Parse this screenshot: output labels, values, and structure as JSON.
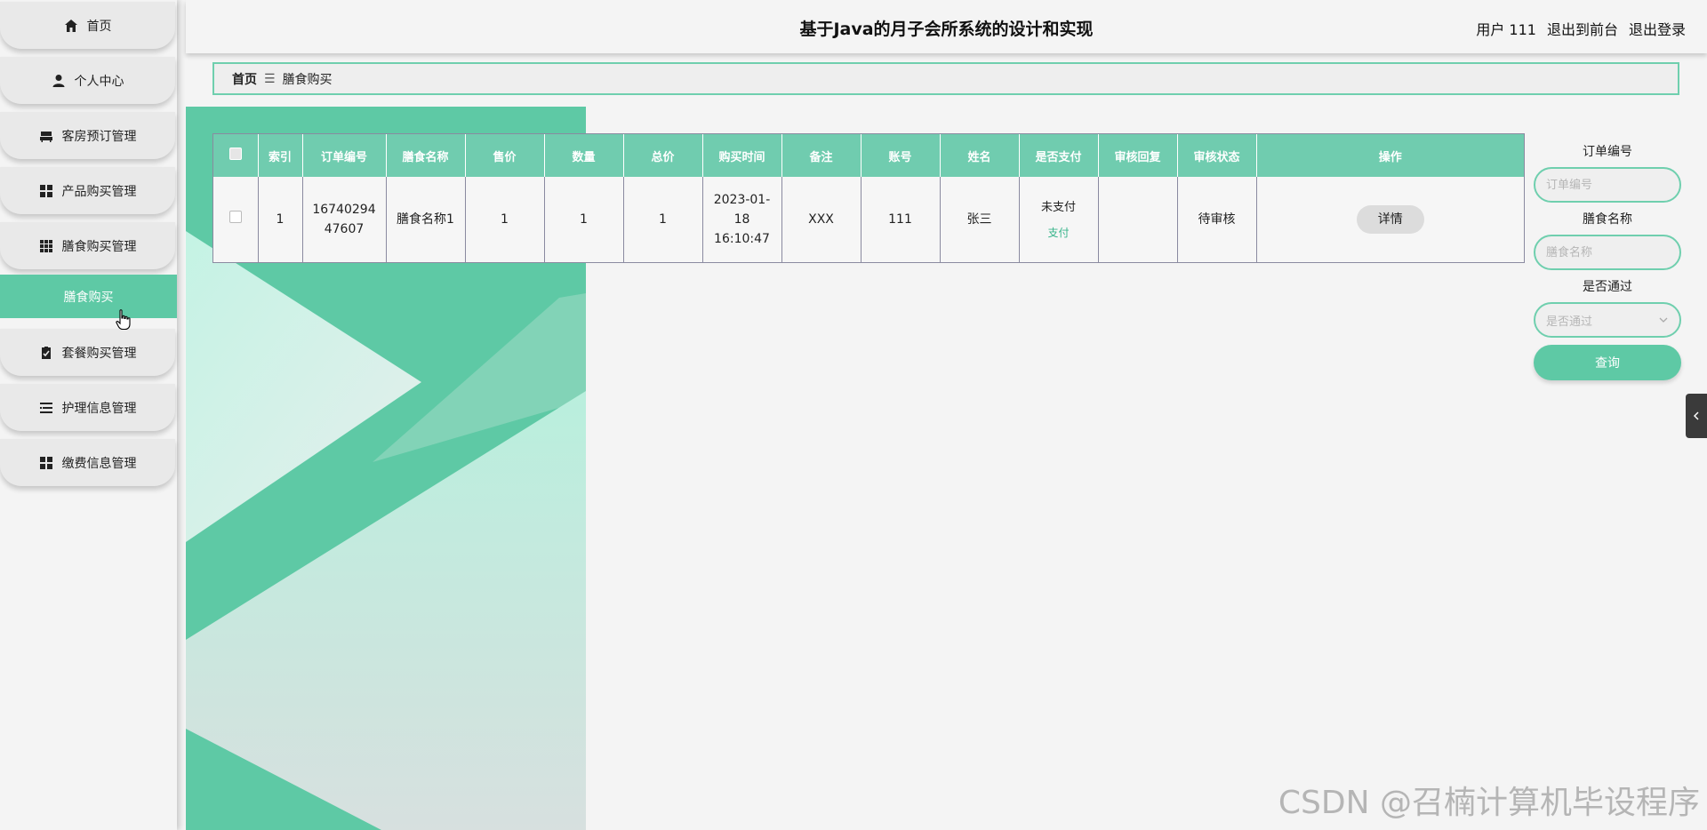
{
  "sidebar": {
    "items": [
      {
        "label": "首页",
        "icon": "home-icon"
      },
      {
        "label": "个人中心",
        "icon": "user-icon"
      },
      {
        "label": "客房预订管理",
        "icon": "bed-icon"
      },
      {
        "label": "产品购买管理",
        "icon": "grid-icon"
      },
      {
        "label": "膳食购买管理",
        "icon": "apps-icon"
      },
      {
        "label": "套餐购买管理",
        "icon": "clipboard-icon"
      },
      {
        "label": "护理信息管理",
        "icon": "list-icon"
      },
      {
        "label": "缴费信息管理",
        "icon": "grid-icon"
      }
    ],
    "active_sub": "膳食购买"
  },
  "header": {
    "title": "基于Java的月子会所系统的设计和实现",
    "user_label": "用户 111",
    "to_front": "退出到前台",
    "logout": "退出登录"
  },
  "breadcrumb": {
    "home": "首页",
    "sep": "☰",
    "current": "膳食购买"
  },
  "table": {
    "headers": [
      "索引",
      "订单编号",
      "膳食名称",
      "售价",
      "数量",
      "总价",
      "购买时间",
      "备注",
      "账号",
      "姓名",
      "是否支付",
      "审核回复",
      "审核状态",
      "操作"
    ],
    "rows": [
      {
        "index": "1",
        "order_no": "1674029447607",
        "name": "膳食名称1",
        "price": "1",
        "qty": "1",
        "total": "1",
        "time": "2023-01-18 16:10:47",
        "remark": "XXX",
        "account": "111",
        "person": "张三",
        "paid": "未支付",
        "pay_action": "支付",
        "reply": "",
        "status": "待审核",
        "detail": "详情"
      }
    ]
  },
  "search": {
    "order_no_label": "订单编号",
    "order_no_placeholder": "订单编号",
    "name_label": "膳食名称",
    "name_placeholder": "膳食名称",
    "pass_label": "是否通过",
    "pass_placeholder": "是否通过",
    "query_label": "查询"
  },
  "watermark": "CSDN @召楠计算机毕设程序",
  "colors": {
    "accent": "#5ec9a5",
    "header_row": "#70ccaf",
    "border": "#6fcfae"
  }
}
